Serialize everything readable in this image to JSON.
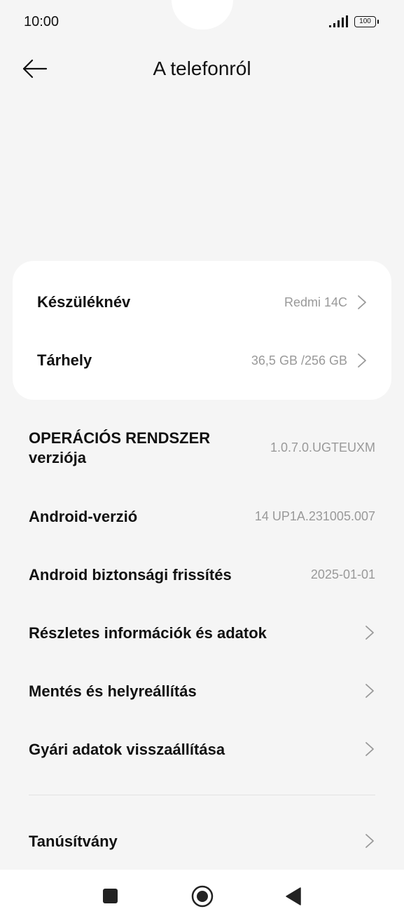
{
  "status_bar": {
    "time": "10:00",
    "battery": "100",
    "icons": [
      "signal-icon",
      "battery-icon"
    ]
  },
  "header": {
    "title": "A telefonról",
    "back_icon": "arrow-left-icon"
  },
  "card": {
    "rows": [
      {
        "label": "Készüléknév",
        "value": "Redmi 14C"
      },
      {
        "label": "Tárhely",
        "value": "36,5 GB /256 GB"
      }
    ]
  },
  "info": {
    "os_version": {
      "label": "OPERÁCIÓS RENDSZER verziója",
      "value": "1.0.7.0.UGTEUXM"
    },
    "android_version": {
      "label": "Android-verzió",
      "value": "14 UP1A.231005.007"
    },
    "security_patch": {
      "label": "Android biztonsági frissítés",
      "value": "2025-01-01"
    }
  },
  "menu": {
    "details": "Részletes információk és adatok",
    "backup": "Mentés és helyreállítás",
    "factory_reset": "Gyári adatok visszaállítása",
    "certification": "Tanúsítvány"
  },
  "nav_bar": {
    "icons": [
      "square-recents-icon",
      "circle-home-icon",
      "triangle-back-icon"
    ]
  },
  "colors": {
    "background": "#f5f5f5",
    "card": "#ffffff",
    "primary_text": "#111111",
    "secondary_text": "#999999",
    "divider": "#e2e2e2"
  }
}
